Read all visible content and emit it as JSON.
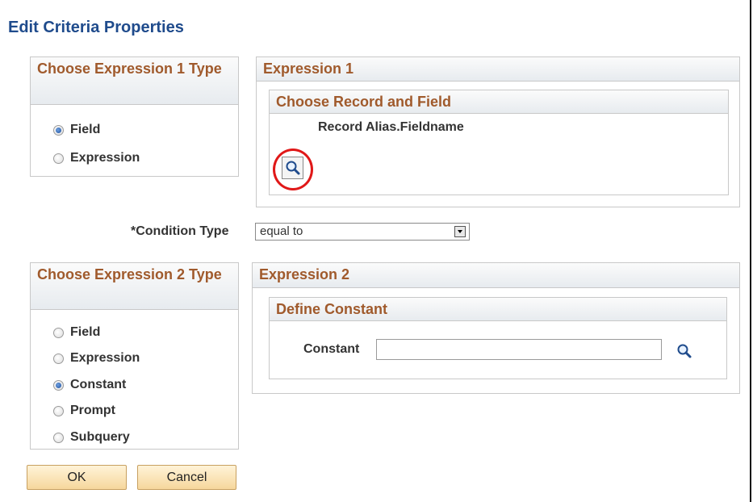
{
  "page": {
    "title": "Edit Criteria Properties"
  },
  "expr1_type": {
    "header": "Choose Expression 1 Type",
    "options": [
      {
        "label": "Field",
        "checked": true
      },
      {
        "label": "Expression",
        "checked": false
      }
    ]
  },
  "expression1": {
    "header": "Expression 1",
    "sub_header": "Choose Record and Field",
    "field_label": "Record Alias.Fieldname",
    "lookup_icon": "magnifier-icon",
    "highlight_color": "#e01818"
  },
  "condition": {
    "label": "*Condition Type",
    "value": "equal to"
  },
  "expr2_type": {
    "header": "Choose Expression 2 Type",
    "options": [
      {
        "label": "Field",
        "checked": false
      },
      {
        "label": "Expression",
        "checked": false
      },
      {
        "label": "Constant",
        "checked": true
      },
      {
        "label": "Prompt",
        "checked": false
      },
      {
        "label": "Subquery",
        "checked": false
      }
    ]
  },
  "expression2": {
    "header": "Expression 2",
    "sub_header": "Define Constant",
    "constant_label": "Constant",
    "constant_value": "",
    "lookup_icon": "magnifier-icon"
  },
  "buttons": {
    "ok": "OK",
    "cancel": "Cancel"
  },
  "colors": {
    "title": "#1f4b8c",
    "section_header_text": "#a05a2c",
    "button_bg": "#f6d79c",
    "radio_selected": "#1d4f9e"
  }
}
